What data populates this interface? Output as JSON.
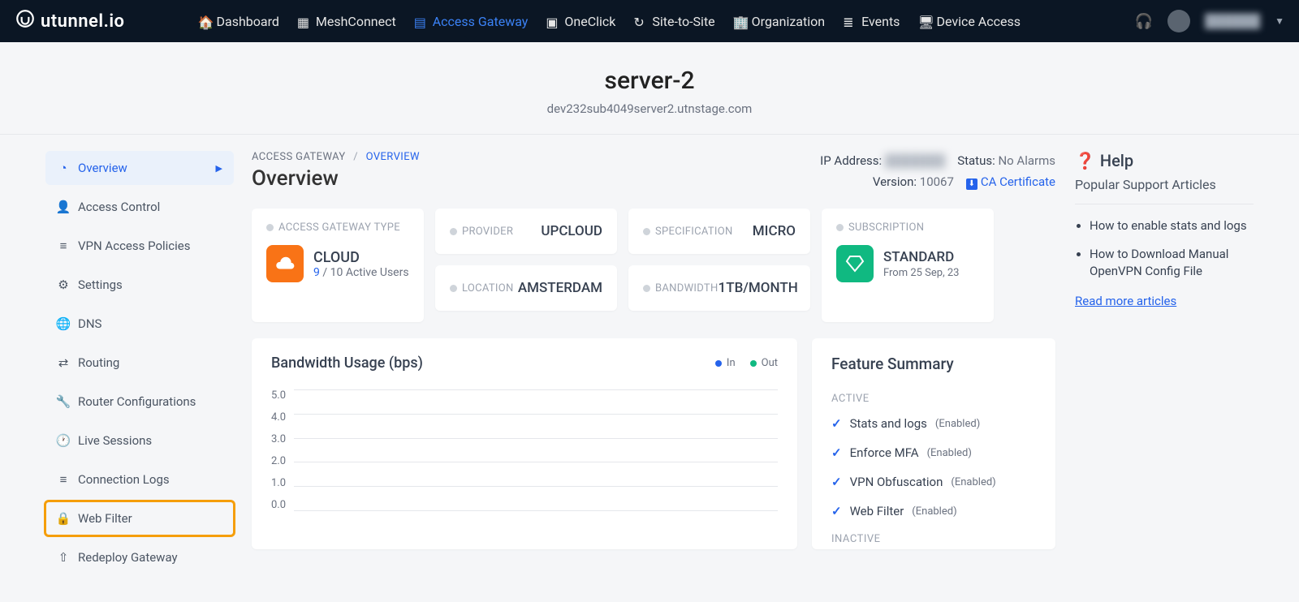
{
  "brand": {
    "name": "utunnel.io"
  },
  "nav": {
    "items": [
      {
        "label": "Dashboard"
      },
      {
        "label": "MeshConnect"
      },
      {
        "label": "Access Gateway"
      },
      {
        "label": "OneClick"
      },
      {
        "label": "Site-to-Site"
      },
      {
        "label": "Organization"
      },
      {
        "label": "Events"
      },
      {
        "label": "Device Access"
      }
    ],
    "user": "██████"
  },
  "server": {
    "title": "server-2",
    "domain": "dev232sub4049server2.utnstage.com"
  },
  "sidebar": {
    "items": [
      {
        "label": "Overview"
      },
      {
        "label": "Access Control"
      },
      {
        "label": "VPN Access Policies"
      },
      {
        "label": "Settings"
      },
      {
        "label": "DNS"
      },
      {
        "label": "Routing"
      },
      {
        "label": "Router Configurations"
      },
      {
        "label": "Live Sessions"
      },
      {
        "label": "Connection Logs"
      },
      {
        "label": "Web Filter"
      },
      {
        "label": "Redeploy Gateway"
      }
    ]
  },
  "breadcrumb": {
    "root": "ACCESS GATEWAY",
    "current": "OVERVIEW"
  },
  "page": {
    "title": "Overview"
  },
  "status": {
    "ip_label": "IP Address:",
    "ip_value": "███████",
    "status_label": "Status:",
    "status_value": "No Alarms",
    "version_label": "Version:",
    "version_value": "10067",
    "ca_label": "CA Certificate"
  },
  "info": {
    "type_label": "ACCESS GATEWAY TYPE",
    "type_value": "CLOUD",
    "users_current": "9",
    "users_sep": " / ",
    "users_max": "10",
    "users_suffix": " Active Users",
    "provider_label": "PROVIDER",
    "provider_value": "UPCLOUD",
    "spec_label": "SPECIFICATION",
    "spec_value": "MICRO",
    "location_label": "LOCATION",
    "location_value": "AMSTERDAM",
    "bandwidth_label": "BANDWIDTH",
    "bandwidth_value": "1TB/MONTH",
    "sub_label": "SUBSCRIPTION",
    "sub_value": "STANDARD",
    "sub_date": "From 25 Sep, 23"
  },
  "chart_data": {
    "type": "line",
    "title": "Bandwidth Usage (bps)",
    "ylabel": "",
    "ylim": [
      0,
      5
    ],
    "y_ticks": [
      "5.0",
      "4.0",
      "3.0",
      "2.0",
      "1.0",
      "0.0"
    ],
    "series": [
      {
        "name": "In",
        "values": [],
        "color": "#2563eb"
      },
      {
        "name": "Out",
        "values": [],
        "color": "#10b981"
      }
    ]
  },
  "features": {
    "title": "Feature Summary",
    "active_label": "ACTIVE",
    "inactive_label": "INACTIVE",
    "active": [
      {
        "name": "Stats and logs",
        "state": "(Enabled)"
      },
      {
        "name": "Enforce MFA",
        "state": "(Enabled)"
      },
      {
        "name": "VPN Obfuscation",
        "state": "(Enabled)"
      },
      {
        "name": "Web Filter",
        "state": "(Enabled)"
      }
    ]
  },
  "help": {
    "title": "Help",
    "subtitle": "Popular Support Articles",
    "articles": [
      "How to enable stats and logs",
      "How to Download Manual OpenVPN Config File"
    ],
    "more": "Read more articles"
  }
}
